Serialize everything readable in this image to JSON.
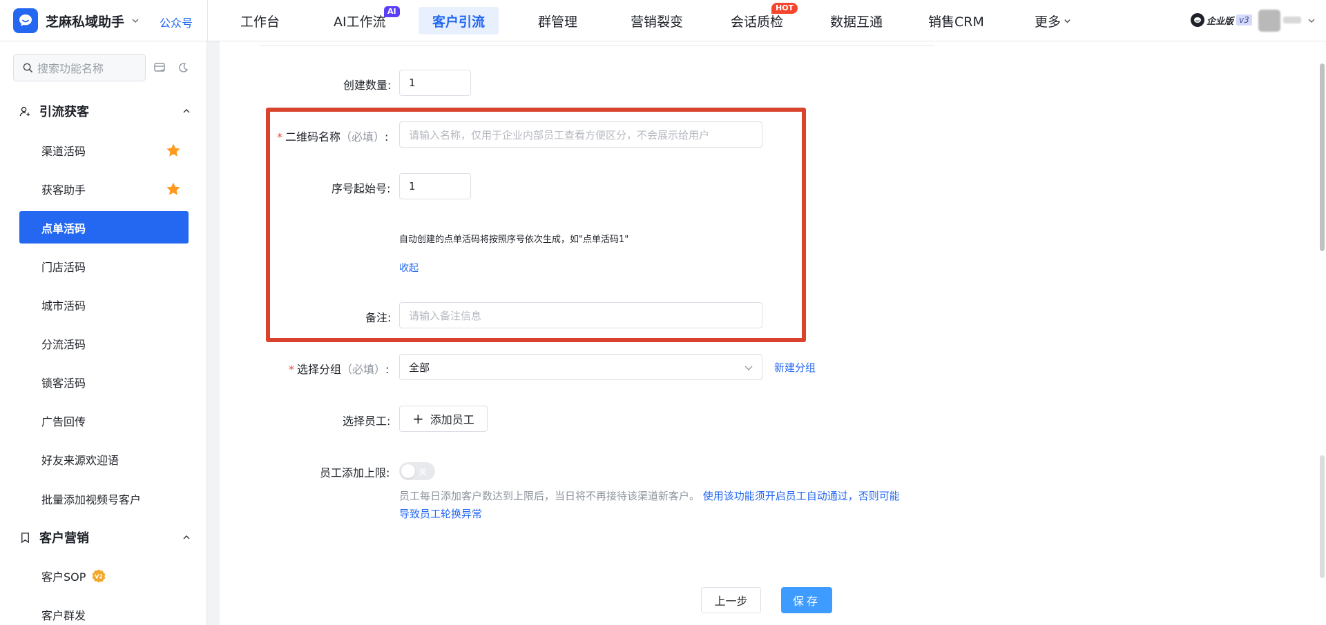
{
  "header": {
    "brand": "芝麻私域助手",
    "gzh_link": "公众号",
    "nav": [
      {
        "label": "工作台"
      },
      {
        "label": "AI工作流",
        "badge": "AI"
      },
      {
        "label": "客户引流",
        "active": true
      },
      {
        "label": "群管理"
      },
      {
        "label": "营销裂变"
      },
      {
        "label": "会话质检",
        "badge": "HOT"
      },
      {
        "label": "数据互通"
      },
      {
        "label": "销售CRM"
      },
      {
        "label": "更多"
      }
    ],
    "enterprise_label": "企业版",
    "enterprise_version": "v3"
  },
  "sidebar": {
    "search_placeholder": "搜索功能名称",
    "groups": [
      {
        "label": "引流获客",
        "items": [
          {
            "label": "渠道活码",
            "starred": true
          },
          {
            "label": "获客助手",
            "starred": true
          },
          {
            "label": "点单活码",
            "active": true
          },
          {
            "label": "门店活码"
          },
          {
            "label": "城市活码"
          },
          {
            "label": "分流活码"
          },
          {
            "label": "锁客活码"
          },
          {
            "label": "广告回传"
          },
          {
            "label": "好友来源欢迎语"
          },
          {
            "label": "批量添加视频号客户"
          }
        ]
      },
      {
        "label": "客户营销",
        "items": [
          {
            "label": "客户SOP",
            "badge": "V2"
          },
          {
            "label": "客户群发"
          }
        ]
      }
    ]
  },
  "form": {
    "create_count_label": "创建数量:",
    "create_count_value": "1",
    "qr_name_label": "二维码名称",
    "qr_name_hint": "（必填）",
    "qr_name_colon": ":",
    "qr_name_placeholder": "请输入名称，仅用于企业内部员工查看方便区分，不会展示给用户",
    "start_no_label": "序号起始号:",
    "start_no_value": "1",
    "auto_hint": "自动创建的点单活码将按照序号依次生成，如\"点单活码1\"",
    "collapse_link": "收起",
    "remark_label": "备注:",
    "remark_placeholder": "请输入备注信息",
    "group_label": "选择分组",
    "group_hint": "（必填）",
    "group_colon": ":",
    "group_value": "全部",
    "new_group_link": "新建分组",
    "staff_label": "选择员工:",
    "add_staff_button": "添加员工",
    "limit_label": "员工添加上限:",
    "limit_toggle_text": "关",
    "limit_desc": "员工每日添加客户数达到上限后，当日将不再接待该渠道新客户。",
    "limit_desc_link": "使用该功能须开启员工自动通过，否则可能导致员工轮换异常",
    "prev_button": "上一步",
    "save_button": "保存"
  },
  "colors": {
    "accent": "#2468f2",
    "annotation_frame": "#d9432e",
    "save_button": "#3e9bff"
  }
}
